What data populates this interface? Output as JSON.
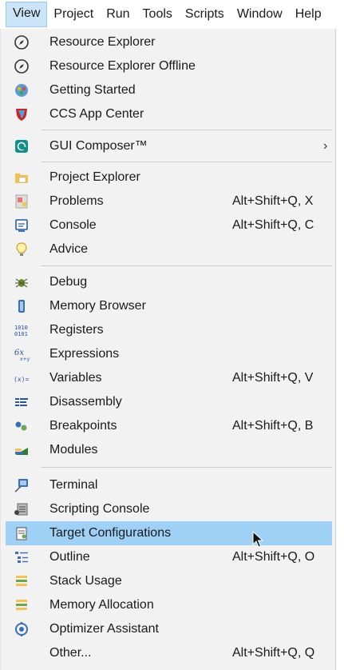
{
  "menubar": {
    "items": [
      "View",
      "Project",
      "Run",
      "Tools",
      "Scripts",
      "Window",
      "Help"
    ]
  },
  "menu": {
    "items": [
      {
        "label": "Resource Explorer",
        "icon": "compass-icon",
        "shortcut": ""
      },
      {
        "label": "Resource Explorer Offline",
        "icon": "compass-icon",
        "shortcut": ""
      },
      {
        "label": "Getting Started",
        "icon": "getting-started-icon",
        "shortcut": ""
      },
      {
        "label": "CCS App Center",
        "icon": "app-center-icon",
        "shortcut": ""
      },
      {
        "label": "GUI Composer™",
        "icon": "gui-composer-icon",
        "shortcut": "",
        "submenu_arrow": "›"
      },
      {
        "label": "Project Explorer",
        "icon": "folder-icon",
        "shortcut": ""
      },
      {
        "label": "Problems",
        "icon": "problems-icon",
        "shortcut": "Alt+Shift+Q, X"
      },
      {
        "label": "Console",
        "icon": "console-icon",
        "shortcut": "Alt+Shift+Q, C"
      },
      {
        "label": "Advice",
        "icon": "lightbulb-icon",
        "shortcut": ""
      },
      {
        "label": "Debug",
        "icon": "bug-icon",
        "shortcut": ""
      },
      {
        "label": "Memory Browser",
        "icon": "memory-icon",
        "shortcut": ""
      },
      {
        "label": "Registers",
        "icon": "registers-icon",
        "shortcut": ""
      },
      {
        "label": "Expressions",
        "icon": "expressions-icon",
        "shortcut": ""
      },
      {
        "label": "Variables",
        "icon": "variables-icon",
        "shortcut": "Alt+Shift+Q, V"
      },
      {
        "label": "Disassembly",
        "icon": "disassembly-icon",
        "shortcut": ""
      },
      {
        "label": "Breakpoints",
        "icon": "breakpoints-icon",
        "shortcut": "Alt+Shift+Q, B"
      },
      {
        "label": "Modules",
        "icon": "modules-icon",
        "shortcut": ""
      },
      {
        "label": "Terminal",
        "icon": "terminal-icon",
        "shortcut": ""
      },
      {
        "label": "Scripting Console",
        "icon": "scripting-console-icon",
        "shortcut": ""
      },
      {
        "label": "Target Configurations",
        "icon": "target-config-icon",
        "shortcut": "",
        "highlighted": true
      },
      {
        "label": "Outline",
        "icon": "outline-icon",
        "shortcut": "Alt+Shift+Q, O"
      },
      {
        "label": "Stack Usage",
        "icon": "stack-usage-icon",
        "shortcut": ""
      },
      {
        "label": "Memory Allocation",
        "icon": "memory-allocation-icon",
        "shortcut": ""
      },
      {
        "label": "Optimizer Assistant",
        "icon": "optimizer-icon",
        "shortcut": ""
      },
      {
        "label": "Other...",
        "icon": "",
        "shortcut": "Alt+Shift+Q, Q"
      }
    ]
  },
  "colors": {
    "highlight": "#9fd0f5",
    "menu_background": "#f2f2f2",
    "active_menubar": "#cce4f7"
  }
}
